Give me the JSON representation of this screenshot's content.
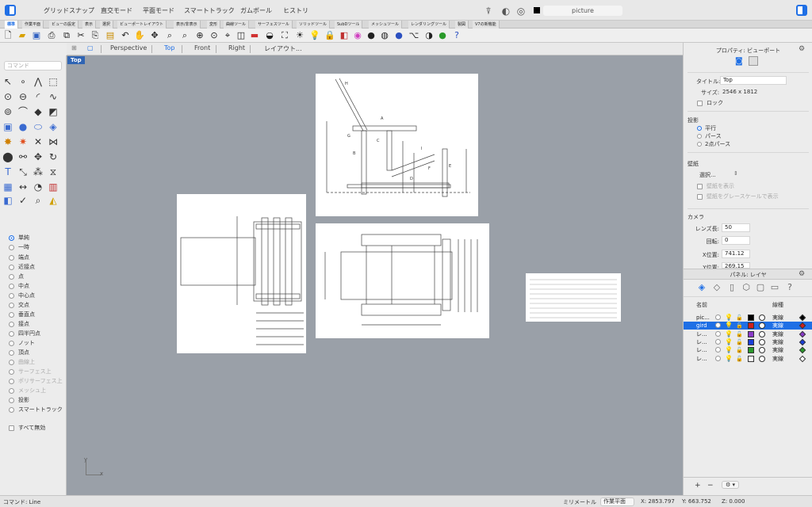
{
  "topbar": {
    "modes": [
      "グリッドスナップ",
      "直交モード",
      "平面モード",
      "スマートトラック",
      "ガムボール",
      "ヒストリ"
    ],
    "layer_name": "picture"
  },
  "tabs": [
    "標準",
    "作業平面",
    "ビューの設定",
    "表示",
    "選択",
    "ビューポートレイアウト",
    "表示/非表示",
    "変形",
    "曲線ツール",
    "サーフェスツール",
    "ソリッドツール",
    "SubDツール",
    "メッシュツール",
    "レンダリングツール",
    "製図",
    "V7の新機能"
  ],
  "viewport_tabs": [
    "Perspective",
    "Top",
    "Front",
    "Right",
    "レイアウト..."
  ],
  "viewport": {
    "label": "Top",
    "axis_x": "x",
    "axis_y": "y"
  },
  "left": {
    "command_placeholder": "コマンド",
    "snaps": [
      "端点",
      "近接点",
      "点",
      "中点",
      "中心点",
      "交点",
      "垂直点",
      "接点",
      "四半円点",
      "ノット",
      "頂点",
      "曲線上",
      "サーフェス上",
      "ポリサーフェス上",
      "メッシュ上",
      "投影",
      "スマートトラック"
    ],
    "snap_mode_selected": "単純",
    "snap_mode_other": "一時",
    "disable_all": "すべて無効"
  },
  "properties": {
    "header": "プロパティ: ビューポート",
    "title_label": "タイトル:",
    "title_value": "Top",
    "size_label": "サイズ:",
    "size_value": "2546 x 1812",
    "lock_label": "ロック",
    "projection_section": "投影",
    "projection_options": [
      "平行",
      "パース",
      "2点パース"
    ],
    "wallpaper_section": "壁紙",
    "wallpaper_select": "選択...",
    "wallpaper_show": "壁紙を表示",
    "wallpaper_gray": "壁紙をグレースケールで表示",
    "camera_section": "カメラ",
    "lens_label": "レンズ長:",
    "lens_value": "50",
    "rotation_label": "回転:",
    "rotation_value": "0",
    "xpos_label": "X位置:",
    "xpos_value": "741.12",
    "ypos_label": "Y位置:",
    "ypos_value": "269.15"
  },
  "layers": {
    "header": "パネル: レイヤ",
    "col_name": "名前",
    "col_linetype": "線種",
    "rows": [
      {
        "name": "pic...",
        "color": "#000000",
        "linetype": "実線",
        "selected": false
      },
      {
        "name": "gird",
        "color": "#d0201c",
        "linetype": "実線",
        "selected": true
      },
      {
        "name": "レ...",
        "color": "#8a3ac8",
        "linetype": "実線",
        "selected": false
      },
      {
        "name": "レ...",
        "color": "#1b3fd8",
        "linetype": "実線",
        "selected": false
      },
      {
        "name": "レ...",
        "color": "#2c9a2c",
        "linetype": "実線",
        "selected": false
      },
      {
        "name": "レ...",
        "color": "#ffffff",
        "linetype": "実線",
        "selected": false
      }
    ],
    "add": "+",
    "remove": "−"
  },
  "status": {
    "command": "コマンド: Line",
    "unit": "ミリメートル",
    "cplane": "作業平面",
    "x": "X: 2853.797",
    "y": "Y: 663.752",
    "z": "Z: 0.000"
  },
  "colors": {
    "accent": "#1f6fe5",
    "viewport_bg": "#9aa0a8"
  }
}
